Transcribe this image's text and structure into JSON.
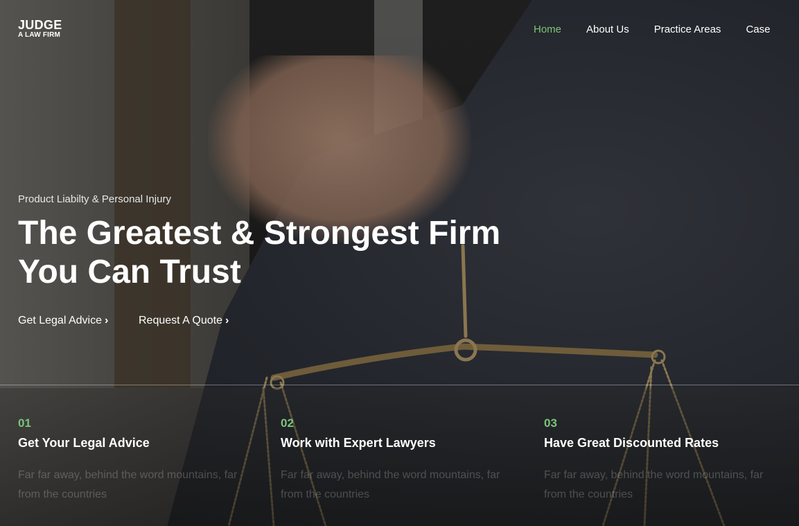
{
  "logo": {
    "brand": "JUDGE",
    "tagline": "A LAW FIRM"
  },
  "nav": [
    {
      "label": "Home"
    },
    {
      "label": "About Us"
    },
    {
      "label": "Practice Areas"
    },
    {
      "label": "Case"
    }
  ],
  "hero": {
    "kicker": "Product Liabilty & Personal Injury",
    "headline_line1": "The Greatest & Strongest Firm",
    "headline_line2": "You Can Trust",
    "cta_primary": "Get Legal Advice",
    "cta_secondary": "Request A Quote",
    "chevron": "›"
  },
  "features": [
    {
      "num": "01",
      "title": "Get Your Legal Advice",
      "text": "Far far away, behind the word mountains, far from the countries"
    },
    {
      "num": "02",
      "title": "Work with Expert Lawyers",
      "text": "Far far away, behind the word mountains, far from the countries"
    },
    {
      "num": "03",
      "title": "Have Great Discounted Rates",
      "text": "Far far away, behind the word mountains, far from the countries"
    }
  ],
  "colors": {
    "accent": "#7cc47b",
    "text": "#ffffff"
  }
}
